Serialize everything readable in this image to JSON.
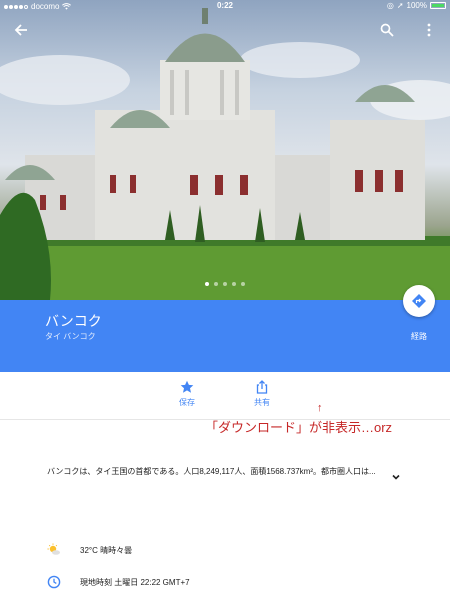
{
  "status": {
    "carrier": "docomo",
    "time": "0:22",
    "battery": "100%"
  },
  "hero": {
    "pager_count": 5,
    "pager_active": 0
  },
  "place": {
    "name": "バンコク",
    "subtitle": "タイ バンコク",
    "route_label": "経路"
  },
  "actions": {
    "save_label": "保存",
    "share_label": "共有"
  },
  "annotation": {
    "text": "「ダウンロード」が非表示…orz",
    "arrow": "↑"
  },
  "description": "バンコクは、タイ王国の首都である。人口8,249,117人、面積1568.737km²。都市圏人口は...",
  "weather": "32°C 晴時々曇",
  "local_time": "現地時刻 土曜日 22:22 GMT+7",
  "colors": {
    "accent": "#4285f4",
    "annotation": "#c62828"
  }
}
